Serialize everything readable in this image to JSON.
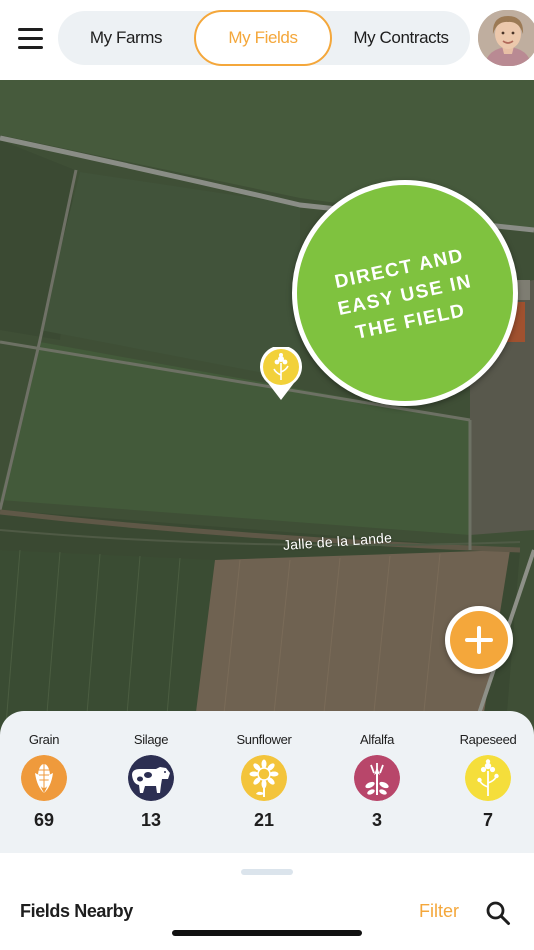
{
  "header": {
    "tabs": [
      {
        "label": "My Farms",
        "active": false
      },
      {
        "label": "My Fields",
        "active": true
      },
      {
        "label": "My Contracts",
        "active": false
      }
    ],
    "menu_icon": "hamburger-menu-icon",
    "avatar": "user-avatar"
  },
  "map": {
    "promo_badge": {
      "lines": [
        "DIRECT AND",
        "EASY USE IN",
        "THE FIELD"
      ],
      "color": "#7fc23f"
    },
    "road_label": "Jalle de la Lande",
    "field_pin": {
      "icon": "rapeseed-flower-icon",
      "color": "#f2d13a"
    },
    "add_button": {
      "icon": "plus-icon",
      "color": "#f4a73b"
    }
  },
  "crops": [
    {
      "label": "Grain",
      "count": "69",
      "icon": "corn-icon",
      "color": "#ef9a3c"
    },
    {
      "label": "Silage",
      "count": "13",
      "icon": "cow-icon",
      "color": "#2c2f52"
    },
    {
      "label": "Sunflower",
      "count": "21",
      "icon": "sunflower-icon",
      "color": "#f3c43b"
    },
    {
      "label": "Alfalfa",
      "count": "3",
      "icon": "alfalfa-icon",
      "color": "#b8466a"
    },
    {
      "label": "Rapeseed",
      "count": "7",
      "icon": "rapeseed-icon",
      "color": "#f5de3b"
    }
  ],
  "bottom_sheet": {
    "title": "Fields Nearby",
    "filter_label": "Filter",
    "search_icon": "search-icon"
  },
  "colors": {
    "accent": "#f4a73b",
    "panel_background": "#eef2f5"
  }
}
